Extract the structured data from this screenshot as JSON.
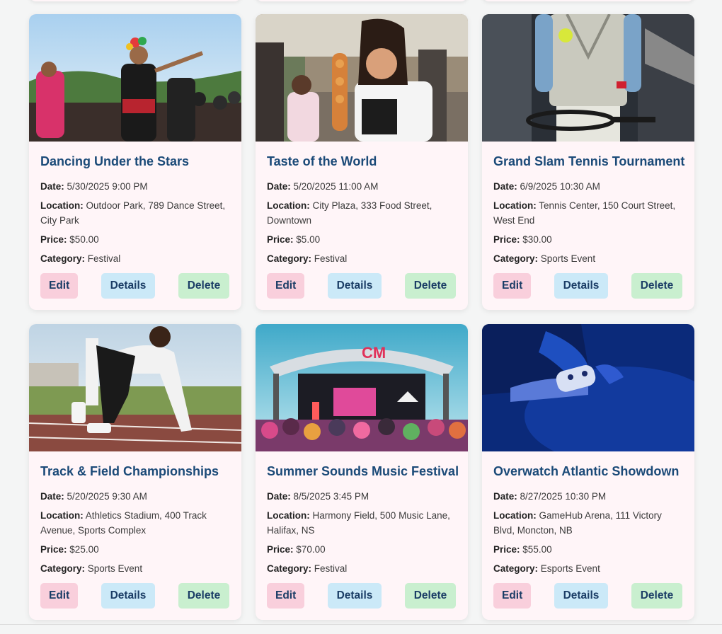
{
  "labels": {
    "date": "Date:",
    "location": "Location:",
    "price": "Price:",
    "category": "Category:"
  },
  "buttons": {
    "edit": "Edit",
    "details": "Details",
    "delete": "Delete"
  },
  "events": [
    {
      "title": "Dancing Under the Stars",
      "date": "5/30/2025 9:00 PM",
      "location": "Outdoor Park, 789 Dance Street, City Park",
      "price": "$50.00",
      "category": "Festival",
      "image": "folk-dancers-photo"
    },
    {
      "title": "Taste of the World",
      "date": "5/20/2025 11:00 AM",
      "location": "City Plaza, 333 Food Street, Downtown",
      "price": "$5.00",
      "category": "Festival",
      "image": "street-food-photo"
    },
    {
      "title": "Grand Slam Tennis Tournament",
      "date": "6/9/2025 10:30 AM",
      "location": "Tennis Center, 150 Court Street, West End",
      "price": "$30.00",
      "category": "Sports Event",
      "image": "tennis-player-photo"
    },
    {
      "title": "Track & Field Championships",
      "date": "5/20/2025 9:30 AM",
      "location": "Athletics Stadium, 400 Track Avenue, Sports Complex",
      "price": "$25.00",
      "category": "Sports Event",
      "image": "sprinter-photo"
    },
    {
      "title": "Summer Sounds Music Festival",
      "date": "8/5/2025 3:45 PM",
      "location": "Harmony Field, 500 Music Lane, Halifax, NS",
      "price": "$70.00",
      "category": "Festival",
      "image": "concert-stage-photo"
    },
    {
      "title": "Overwatch Atlantic Showdown",
      "date": "8/27/2025 10:30 PM",
      "location": "GameHub Arena, 111 Victory Blvd, Moncton, NB",
      "price": "$55.00",
      "category": "Esports Event",
      "image": "game-controller-photo"
    }
  ]
}
